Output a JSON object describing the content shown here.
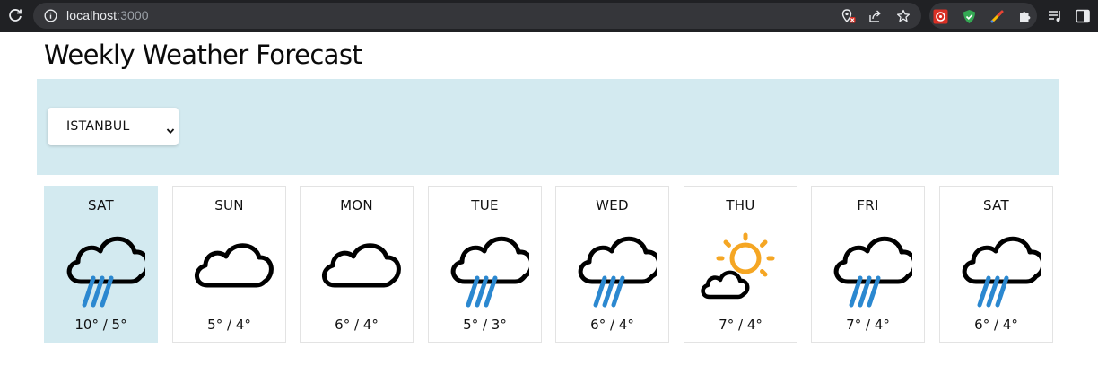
{
  "browser": {
    "url_host": "localhost",
    "url_port": ":3000"
  },
  "page": {
    "title": "Weekly Weather Forecast"
  },
  "city_select": {
    "selected": "ISTANBUL"
  },
  "forecast": [
    {
      "day": "SAT",
      "temp": "10° / 5°",
      "icon": "rain-cloud-icon",
      "selected": true
    },
    {
      "day": "SUN",
      "temp": "5° / 4°",
      "icon": "cloud-icon",
      "selected": false
    },
    {
      "day": "MON",
      "temp": "6° / 4°",
      "icon": "cloud-icon",
      "selected": false
    },
    {
      "day": "TUE",
      "temp": "5° / 3°",
      "icon": "rain-cloud-icon",
      "selected": false
    },
    {
      "day": "WED",
      "temp": "6° / 4°",
      "icon": "rain-cloud-icon",
      "selected": false
    },
    {
      "day": "THU",
      "temp": "7° / 4°",
      "icon": "partly-sunny-icon",
      "selected": false
    },
    {
      "day": "FRI",
      "temp": "7° / 4°",
      "icon": "rain-cloud-icon",
      "selected": false
    },
    {
      "day": "SAT",
      "temp": "6° / 4°",
      "icon": "rain-cloud-icon",
      "selected": false
    }
  ],
  "colors": {
    "banner": "#d3eaf0",
    "rain": "#2b88d0",
    "sun": "#f5a623",
    "chrome": "#202124"
  }
}
